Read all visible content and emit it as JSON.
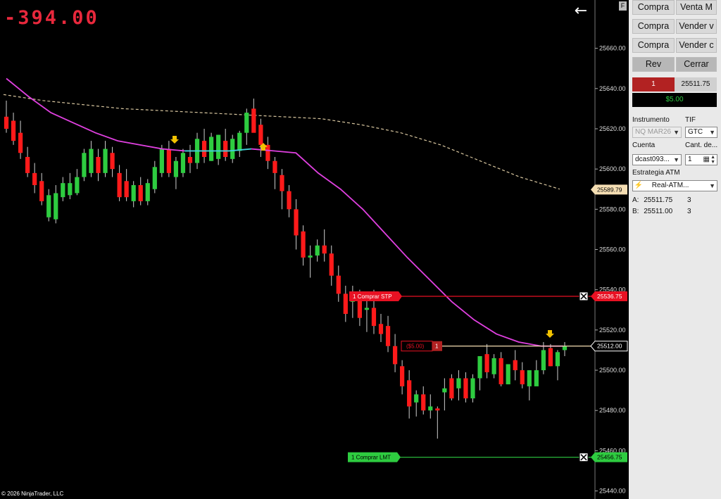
{
  "pnl_display": "-394.00",
  "copyright": "© 2026 NinjaTrader, LLC",
  "f_label": "F",
  "price_axis": {
    "ticks": [
      "25660.00",
      "25640.00",
      "25620.00",
      "25600.00",
      "25580.00",
      "25560.00",
      "25540.00",
      "25520.00",
      "25500.00",
      "25480.00",
      "25460.00",
      "25440.00"
    ],
    "tick_values": [
      25660,
      25640,
      25620,
      25600,
      25580,
      25560,
      25540,
      25520,
      25500,
      25480,
      25460,
      25440
    ],
    "markers": [
      {
        "label": "25589.79",
        "value": 25589.79,
        "bg": "#f5deb3",
        "fg": "#000000"
      },
      {
        "label": "25536.75",
        "value": 25536.75,
        "bg": "#e81123",
        "fg": "#ffffff"
      },
      {
        "label": "25512.00",
        "value": 25512.0,
        "bg": "#000000",
        "fg": "#ffffff"
      },
      {
        "label": "25456.75",
        "value": 25456.75,
        "bg": "#2ecc40",
        "fg": "#000000"
      }
    ]
  },
  "orders": {
    "stop": {
      "qty": "1",
      "label": "Comprar STP",
      "value": 25536.75,
      "color": "#e81123"
    },
    "limit": {
      "qty": "1",
      "label": "Comprar LMT",
      "value": 25456.75,
      "color": "#2ecc40"
    },
    "position": {
      "pnl": "($5.00)",
      "qty": "1",
      "value": 25512.0
    }
  },
  "chart_data": {
    "type": "candlestick",
    "y_range": [
      25436,
      25684
    ],
    "candles": [
      [
        25626,
        25634,
        25618,
        25620
      ],
      [
        25624,
        25628,
        25612,
        25614
      ],
      [
        25618,
        25624,
        25605,
        25608
      ],
      [
        25606,
        25611,
        25596,
        25598
      ],
      [
        25598,
        25603,
        25588,
        25592
      ],
      [
        25594,
        25598,
        25582,
        25584
      ],
      [
        25576,
        25590,
        25574,
        25587
      ],
      [
        25575,
        25592,
        25573,
        25588
      ],
      [
        25586,
        25596,
        25584,
        25593
      ],
      [
        25587,
        25598,
        25585,
        25593
      ],
      [
        25588,
        25600,
        25587,
        25596
      ],
      [
        25596,
        25610,
        25594,
        25608
      ],
      [
        25598,
        25614,
        25596,
        25610
      ],
      [
        25606,
        25610,
        25594,
        25598
      ],
      [
        25598,
        25614,
        25596,
        25610
      ],
      [
        25608,
        25611,
        25596,
        25600
      ],
      [
        25598,
        25602,
        25584,
        25586
      ],
      [
        25594,
        25600,
        25584,
        25586
      ],
      [
        25584,
        25594,
        25581,
        25592
      ],
      [
        25592,
        25596,
        25582,
        25584
      ],
      [
        25584,
        25595,
        25582,
        25593
      ],
      [
        25590,
        25604,
        25588,
        25601
      ],
      [
        25598,
        25612,
        25596,
        25610
      ],
      [
        25610,
        25614,
        25596,
        25598
      ],
      [
        25596,
        25606,
        25590,
        25604
      ],
      [
        25598,
        25610,
        25596,
        25608
      ],
      [
        25606,
        25612,
        25598,
        25603
      ],
      [
        25603,
        25618,
        25600,
        25615
      ],
      [
        25614,
        25620,
        25603,
        25606
      ],
      [
        25604,
        25618,
        25604,
        25616
      ],
      [
        25605,
        25617,
        25602,
        25617
      ],
      [
        25614,
        25620,
        25604,
        25606
      ],
      [
        25605,
        25617,
        25603,
        25615
      ],
      [
        25609,
        25619,
        25606,
        25618
      ],
      [
        25618,
        25630,
        25612,
        25628
      ],
      [
        25630,
        25635,
        25622,
        25618
      ],
      [
        25622,
        25625,
        25606,
        25612
      ],
      [
        25612,
        25616,
        25600,
        25604
      ],
      [
        25604,
        25606,
        25590,
        25598
      ],
      [
        25597,
        25600,
        25580,
        25589
      ],
      [
        25589,
        25592,
        25576,
        25580
      ],
      [
        25580,
        25585,
        25560,
        25567
      ],
      [
        25569,
        25572,
        25552,
        25556
      ],
      [
        25556,
        25562,
        25546,
        25557
      ],
      [
        25557,
        25565,
        25554,
        25562
      ],
      [
        25562,
        25570,
        25554,
        25558
      ],
      [
        25558,
        25562,
        25542,
        25547
      ],
      [
        25547,
        25552,
        25534,
        25538
      ],
      [
        25538,
        25542,
        25524,
        25528
      ],
      [
        25534,
        25542,
        25526,
        25536
      ],
      [
        25535,
        25540,
        25522,
        25526
      ],
      [
        25530,
        25535,
        25519,
        25531
      ],
      [
        25531,
        25540,
        25518,
        25522
      ],
      [
        25523,
        25528,
        25514,
        25518
      ],
      [
        25522,
        25527,
        25509,
        25512
      ],
      [
        25512,
        25518,
        25499,
        25503
      ],
      [
        25502,
        25505,
        25488,
        25492
      ],
      [
        25495,
        25500,
        25476,
        25482
      ],
      [
        25484,
        25490,
        25477,
        25488
      ],
      [
        25488,
        25492,
        25478,
        25480
      ],
      [
        25480,
        25488,
        25476,
        25482
      ],
      [
        25481,
        25482,
        25466,
        25480
      ],
      [
        25489,
        25496,
        25480,
        25491
      ],
      [
        25496,
        25498,
        25485,
        25486
      ],
      [
        25491,
        25500,
        25485,
        25496
      ],
      [
        25496,
        25499,
        25484,
        25486
      ],
      [
        25486,
        25498,
        25484,
        25496
      ],
      [
        25496,
        25505,
        25490,
        25507
      ],
      [
        25508,
        25513,
        25496,
        25499
      ],
      [
        25498,
        25508,
        25496,
        25506
      ],
      [
        25506,
        25509,
        25492,
        25493
      ],
      [
        25493,
        25500,
        25493,
        25503
      ],
      [
        25505,
        25510,
        25495,
        25500
      ],
      [
        25500,
        25504,
        25491,
        25493
      ],
      [
        25492,
        25500,
        25485,
        25500
      ],
      [
        25492,
        25505,
        25493,
        25500
      ],
      [
        25500,
        25514,
        25498,
        25510
      ],
      [
        25511,
        25513,
        25502,
        25502
      ],
      [
        25502,
        25510,
        25495,
        25509
      ],
      [
        25510,
        25514,
        25507,
        25512
      ]
    ],
    "ma_trend": [
      25645,
      25636,
      25628,
      25623,
      25618,
      25614,
      25612,
      25610,
      25609,
      25609,
      25609,
      25610,
      25609,
      25608,
      25598,
      25590,
      25580,
      25568,
      25556,
      25545,
      25534,
      25525,
      25518,
      25514,
      25512,
      25512
    ],
    "ma_slow": [
      25637,
      25634,
      25632,
      25630,
      25629,
      25628,
      25627,
      25626,
      25625,
      25622,
      25618,
      25612,
      25604,
      25596,
      25590
    ]
  },
  "sidebar": {
    "buttons": [
      {
        "label": "Compra"
      },
      {
        "label": "Venta M"
      },
      {
        "label": "Compra"
      },
      {
        "label": "Vender v"
      },
      {
        "label": "Compra"
      },
      {
        "label": "Vender c"
      },
      {
        "label": "Rev"
      },
      {
        "label": "Cerrar"
      }
    ],
    "qty": "1",
    "price": "25511.75",
    "pnl": "$5.00",
    "instrument_label": "Instrumento",
    "instrument_value": "NQ MAR26",
    "tif_label": "TIF",
    "tif_value": "GTC",
    "account_label": "Cuenta",
    "account_value": "dcast093...",
    "qty_label": "Cant. de...",
    "qty_value": "1",
    "atm_label": "Estrategia ATM",
    "atm_value": "Real-ATM...",
    "ask_label": "A:",
    "ask_price": "25511.75",
    "ask_size": "3",
    "bid_label": "B:",
    "bid_price": "25511.00",
    "bid_size": "3"
  }
}
